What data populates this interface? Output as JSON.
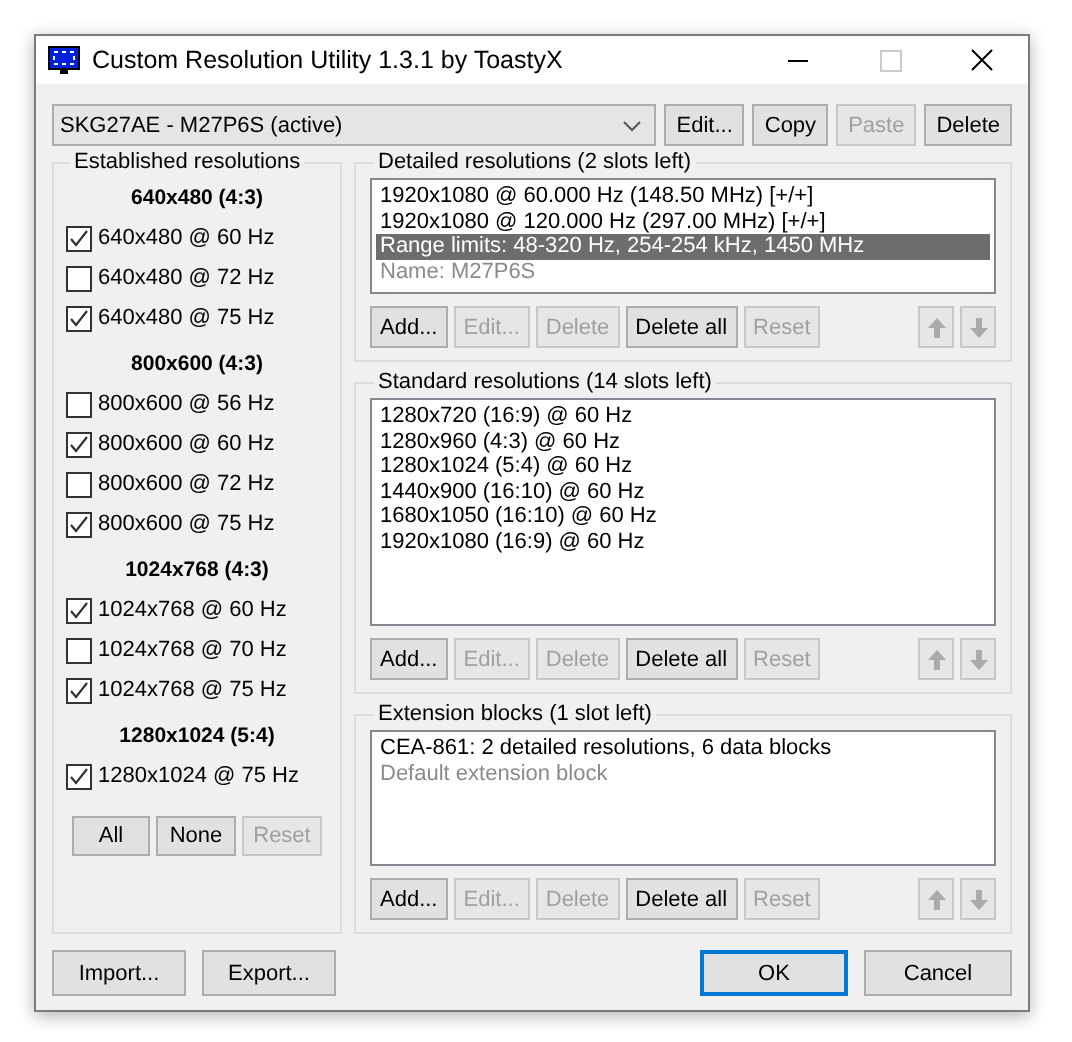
{
  "window": {
    "title": "Custom Resolution Utility 1.3.1 by ToastyX"
  },
  "device_select": {
    "value": "SKG27AE - M27P6S (active)"
  },
  "device_buttons": [
    {
      "label": "Edit...",
      "disabled": false
    },
    {
      "label": "Copy",
      "disabled": false
    },
    {
      "label": "Paste",
      "disabled": true
    },
    {
      "label": "Delete",
      "disabled": false
    }
  ],
  "established": {
    "title": "Established resolutions",
    "groups": [
      {
        "heading": "640x480 (4:3)",
        "items": [
          {
            "label": "640x480 @ 60 Hz",
            "checked": true
          },
          {
            "label": "640x480 @ 72 Hz",
            "checked": false
          },
          {
            "label": "640x480 @ 75 Hz",
            "checked": true
          }
        ]
      },
      {
        "heading": "800x600 (4:3)",
        "items": [
          {
            "label": "800x600 @ 56 Hz",
            "checked": false
          },
          {
            "label": "800x600 @ 60 Hz",
            "checked": true
          },
          {
            "label": "800x600 @ 72 Hz",
            "checked": false
          },
          {
            "label": "800x600 @ 75 Hz",
            "checked": true
          }
        ]
      },
      {
        "heading": "1024x768 (4:3)",
        "items": [
          {
            "label": "1024x768 @ 60 Hz",
            "checked": true
          },
          {
            "label": "1024x768 @ 70 Hz",
            "checked": false
          },
          {
            "label": "1024x768 @ 75 Hz",
            "checked": true
          }
        ]
      },
      {
        "heading": "1280x1024 (5:4)",
        "items": [
          {
            "label": "1280x1024 @ 75 Hz",
            "checked": true
          }
        ]
      }
    ],
    "buttons": [
      {
        "label": "All",
        "disabled": false
      },
      {
        "label": "None",
        "disabled": false
      },
      {
        "label": "Reset",
        "disabled": true
      }
    ]
  },
  "sections": [
    {
      "title": "Detailed resolutions (2 slots left)",
      "items": [
        {
          "text": "1920x1080 @ 60.000 Hz (148.50 MHz) [+/+]",
          "selected": false,
          "dimmed": false
        },
        {
          "text": "1920x1080 @ 120.000 Hz (297.00 MHz) [+/+]",
          "selected": false,
          "dimmed": false
        },
        {
          "text": "Range limits: 48-320 Hz, 254-254 kHz, 1450 MHz",
          "selected": true,
          "dimmed": false
        },
        {
          "text": "Name: M27P6S",
          "selected": false,
          "dimmed": true
        }
      ],
      "buttons": [
        {
          "label": "Add...",
          "disabled": false
        },
        {
          "label": "Edit...",
          "disabled": true
        },
        {
          "label": "Delete",
          "disabled": true
        },
        {
          "label": "Delete all",
          "disabled": false
        },
        {
          "label": "Reset",
          "disabled": true
        }
      ]
    },
    {
      "title": "Standard resolutions (14 slots left)",
      "items": [
        {
          "text": "1280x720 (16:9) @ 60 Hz",
          "selected": false,
          "dimmed": false
        },
        {
          "text": "1280x960 (4:3) @ 60 Hz",
          "selected": false,
          "dimmed": false
        },
        {
          "text": "1280x1024 (5:4) @ 60 Hz",
          "selected": false,
          "dimmed": false
        },
        {
          "text": "1440x900 (16:10) @ 60 Hz",
          "selected": false,
          "dimmed": false
        },
        {
          "text": "1680x1050 (16:10) @ 60 Hz",
          "selected": false,
          "dimmed": false
        },
        {
          "text": "1920x1080 (16:9) @ 60 Hz",
          "selected": false,
          "dimmed": false
        }
      ],
      "buttons": [
        {
          "label": "Add...",
          "disabled": false
        },
        {
          "label": "Edit...",
          "disabled": true
        },
        {
          "label": "Delete",
          "disabled": true
        },
        {
          "label": "Delete all",
          "disabled": false
        },
        {
          "label": "Reset",
          "disabled": true
        }
      ]
    },
    {
      "title": "Extension blocks (1 slot left)",
      "items": [
        {
          "text": "CEA-861: 2 detailed resolutions, 6 data blocks",
          "selected": false,
          "dimmed": false
        },
        {
          "text": "Default extension block",
          "selected": false,
          "dimmed": true
        }
      ],
      "buttons": [
        {
          "label": "Add...",
          "disabled": false
        },
        {
          "label": "Edit...",
          "disabled": true
        },
        {
          "label": "Delete",
          "disabled": true
        },
        {
          "label": "Delete all",
          "disabled": false
        },
        {
          "label": "Reset",
          "disabled": true
        }
      ]
    }
  ],
  "footer_left": [
    {
      "label": "Import...",
      "default": false
    },
    {
      "label": "Export...",
      "default": false
    }
  ],
  "footer_right": [
    {
      "label": "OK",
      "default": true
    },
    {
      "label": "Cancel",
      "default": false
    }
  ]
}
